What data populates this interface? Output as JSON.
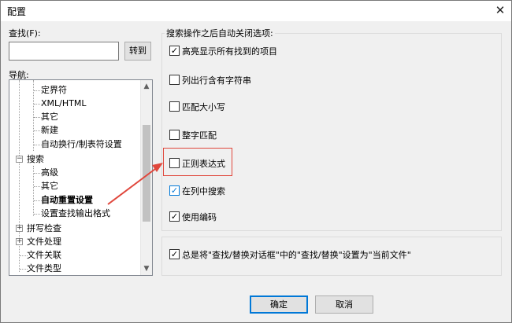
{
  "window": {
    "title": "配置"
  },
  "find": {
    "label": "查找(F):",
    "value": "",
    "goto_button": "转到"
  },
  "nav": {
    "label": "导航:",
    "items": [
      {
        "label": "定界符",
        "bold": false
      },
      {
        "label": "XML/HTML",
        "bold": false
      },
      {
        "label": "其它",
        "bold": false
      },
      {
        "label": "新建",
        "bold": false
      },
      {
        "label": "自动换行/制表符设置",
        "bold": false
      },
      {
        "label": "搜索",
        "bold": false
      },
      {
        "label": "高级",
        "bold": false
      },
      {
        "label": "其它",
        "bold": false
      },
      {
        "label": "自动重置设置",
        "bold": true
      },
      {
        "label": "设置查找输出格式",
        "bold": false
      },
      {
        "label": "拼写检查",
        "bold": false
      },
      {
        "label": "文件处理",
        "bold": false
      },
      {
        "label": "文件关联",
        "bold": false
      },
      {
        "label": "文件类型",
        "bold": false
      }
    ]
  },
  "options": {
    "group_title": "搜索操作之后自动关闭选项:",
    "items": [
      {
        "label": "高亮显示所有找到的项目",
        "checked": true
      },
      {
        "label": "列出行含有字符串",
        "checked": false
      },
      {
        "label": "匹配大小写",
        "checked": false
      },
      {
        "label": "整字匹配",
        "checked": false
      },
      {
        "label": "正则表达式",
        "checked": false
      },
      {
        "label": "在列中搜索",
        "checked": true
      },
      {
        "label": "使用编码",
        "checked": true
      }
    ],
    "bottom_option": {
      "label": "总是将\"查找/替换对话框\"中的\"查找/替换\"设置为\"当前文件\"",
      "checked": true
    }
  },
  "footer": {
    "ok": "确定",
    "cancel": "取消"
  },
  "colors": {
    "accent": "#0078d7",
    "annotation": "#e0473c"
  }
}
